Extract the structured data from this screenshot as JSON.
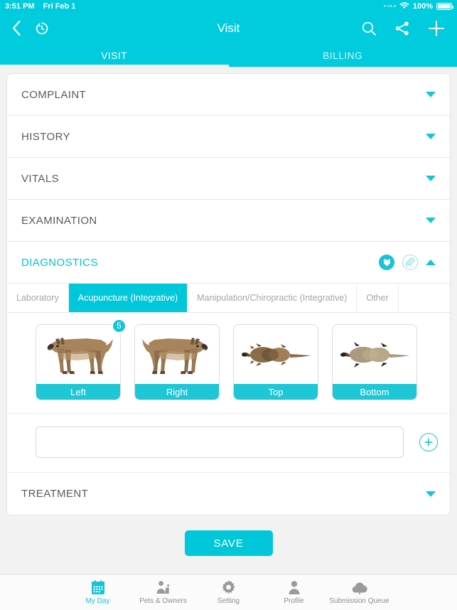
{
  "status_bar": {
    "time": "3:51 PM",
    "date": "Fri Feb 1",
    "battery_percent": "100%",
    "wifi_icon": "wifi-icon",
    "battery_icon": "battery-full-icon"
  },
  "navbar": {
    "title": "Visit",
    "back_icon": "back-chevron-icon",
    "history_icon": "history-clock-icon",
    "search_icon": "search-icon",
    "share_icon": "share-icon",
    "add_icon": "plus-icon"
  },
  "top_tabs": [
    {
      "label": "VISIT",
      "active": true
    },
    {
      "label": "BILLING",
      "active": false
    }
  ],
  "sections": [
    {
      "label": "COMPLAINT",
      "open": false
    },
    {
      "label": "HISTORY",
      "open": false
    },
    {
      "label": "VITALS",
      "open": false
    },
    {
      "label": "EXAMINATION",
      "open": false
    },
    {
      "label": "DIAGNOSTICS",
      "open": true
    },
    {
      "label": "TREATMENT",
      "open": false
    }
  ],
  "diagnostics": {
    "label": "DIAGNOSTICS",
    "dog_icon": "dog-head-icon",
    "attachment_icon": "paperclip-icon",
    "sub_tabs": [
      {
        "label": "Laboratory",
        "active": false
      },
      {
        "label": "Acupuncture (Integrative)",
        "active": true
      },
      {
        "label": "Manipulation/Chiropractic (Integrative)",
        "active": false
      },
      {
        "label": "Other",
        "active": false
      }
    ],
    "view_cards": [
      {
        "label": "Left",
        "badge": "5",
        "view": "dog-lateral-left"
      },
      {
        "label": "Right",
        "badge": "",
        "view": "dog-lateral-right"
      },
      {
        "label": "Top",
        "badge": "",
        "view": "dog-dorsal"
      },
      {
        "label": "Bottom",
        "badge": "",
        "view": "dog-ventral"
      }
    ],
    "note_input": {
      "value": "",
      "placeholder": ""
    },
    "add_button_icon": "plus-circle-icon"
  },
  "save_button": {
    "label": "SAVE"
  },
  "bottom_nav": [
    {
      "label": "My Day",
      "icon": "calendar-icon",
      "active": true
    },
    {
      "label": "Pets & Owners",
      "icon": "pets-owners-icon",
      "active": false
    },
    {
      "label": "Setting",
      "icon": "gear-icon",
      "active": false
    },
    {
      "label": "Profile",
      "icon": "person-icon",
      "active": false
    },
    {
      "label": "Submission Queue",
      "icon": "cloud-upload-icon",
      "active": false
    }
  ],
  "colors": {
    "brand_cyan": "#00CCDD",
    "accent_cyan": "#17C4D6",
    "page_bg": "#f2f2f2",
    "text_gray": "#5a5a5a"
  }
}
